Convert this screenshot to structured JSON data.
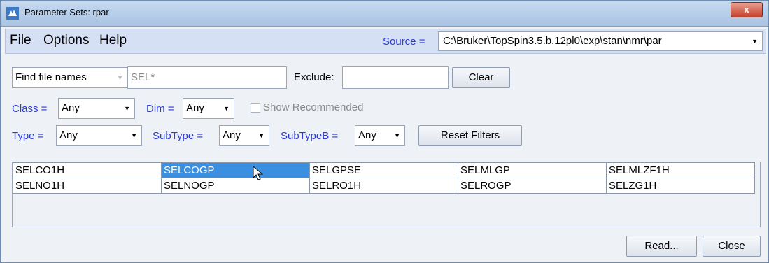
{
  "window": {
    "title": "Parameter Sets: rpar",
    "close_symbol": "x"
  },
  "menu": {
    "file": "File",
    "options": "Options",
    "help": "Help"
  },
  "source": {
    "label": "Source =",
    "value": "C:\\Bruker\\TopSpin3.5.b.12pl0\\exp\\stan\\nmr\\par"
  },
  "search": {
    "mode": "Find file names",
    "pattern": "SEL*",
    "exclude_label": "Exclude:",
    "exclude_value": "",
    "clear_label": "Clear"
  },
  "filters": {
    "class_label": "Class =",
    "class_value": "Any",
    "dim_label": "Dim =",
    "dim_value": "Any",
    "show_recommended": "Show Recommended",
    "type_label": "Type =",
    "type_value": "Any",
    "subtype_label": "SubType =",
    "subtype_value": "Any",
    "subtypeb_label": "SubTypeB =",
    "subtypeb_value": "Any",
    "reset_label": "Reset Filters"
  },
  "results": [
    [
      "SELCO1H",
      "SELCOGP",
      "SELGPSE",
      "SELMLGP",
      "SELMLZF1H"
    ],
    [
      "SELNO1H",
      "SELNOGP",
      "SELRO1H",
      "SELROGP",
      "SELZG1H"
    ]
  ],
  "selected": "SELCOGP",
  "footer": {
    "read_label": "Read...",
    "close_label": "Close"
  },
  "colors": {
    "accent_blue": "#2a3bd6",
    "selection": "#3b8fe0"
  }
}
